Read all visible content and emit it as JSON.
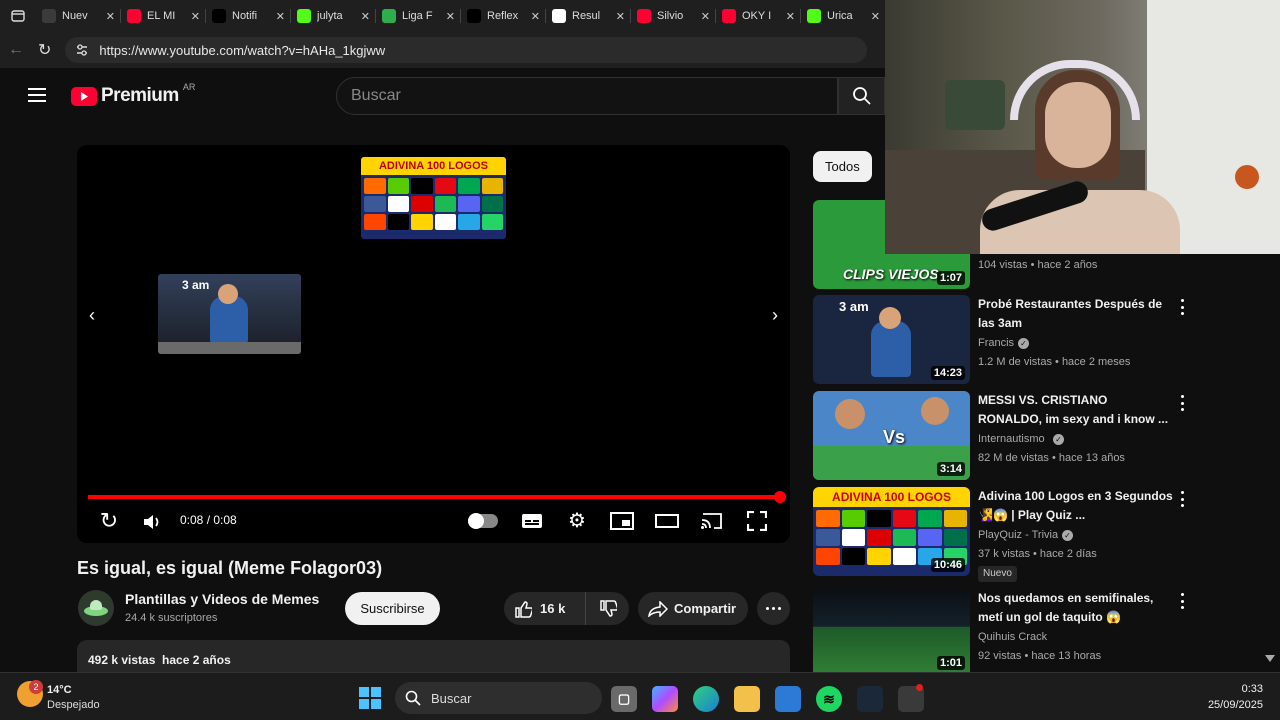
{
  "browser": {
    "tabs": [
      {
        "label": "Nuev",
        "icon": "news-icon",
        "color": "#3b3b3b"
      },
      {
        "label": "EL MI",
        "icon": "youtube-icon",
        "color": "#ff0033"
      },
      {
        "label": "Notifi",
        "icon": "x-icon",
        "color": "#000000"
      },
      {
        "label": "julyta",
        "icon": "kick-icon",
        "color": "#53fc18"
      },
      {
        "label": "Liga F",
        "icon": "soccer-icon",
        "color": "#2eae4e"
      },
      {
        "label": "Reflex",
        "icon": "tiktok-icon",
        "color": "#000000"
      },
      {
        "label": "Resul",
        "icon": "google-icon",
        "color": "#ffffff"
      },
      {
        "label": "Silvio",
        "icon": "youtube-icon",
        "color": "#ff0033"
      },
      {
        "label": "OKY I",
        "icon": "youtube-icon",
        "color": "#ff0033"
      },
      {
        "label": "Urica",
        "icon": "kick-icon",
        "color": "#53fc18"
      }
    ],
    "url": "https://www.youtube.com/watch?v=hAHa_1kgjww"
  },
  "header": {
    "logo_text": "Premium",
    "region": "AR",
    "search_placeholder": "Buscar"
  },
  "player": {
    "time": "0:08 / 0:08",
    "progress": 1.0,
    "end_cards": {
      "big_title_line1": "ADIVINA 100 LOGOS",
      "small_label": "3 am"
    }
  },
  "video": {
    "title": "Es igual, es igual (Meme Folagor03)",
    "channel": "Plantillas y Videos de Memes",
    "subscribers": "24.4 k suscriptores",
    "subscribe_label": "Suscribirse",
    "likes": "16 k",
    "share_label": "Compartir",
    "views_date": "492 k vistas  hace 2 años"
  },
  "sidebar": {
    "chip": "Todos",
    "items": [
      {
        "thumb_text": "CLIPS VIEJOS",
        "duration": "1:07",
        "meta": "104 vistas • hace 2 años",
        "thumb_color": "#2a9a3a"
      },
      {
        "title": "Probé Restaurantes Después de las 3am",
        "channel": "Francis",
        "meta": "1.2 M de vistas • hace 2 meses",
        "duration": "14:23",
        "thumb_text": "3 am",
        "thumb_color": "#1a2540"
      },
      {
        "title": "MESSI VS. CRISTIANO RONALDO, im sexy and i know ...",
        "channel": "Internautismo",
        "meta": "82 M de vistas • hace 13 años",
        "duration": "3:14",
        "thumb_text": "Vs",
        "thumb_color": "#4a86c8"
      },
      {
        "title": "Adivina 100 Logos en 3 Segundos 🧏‍♀️😱 | Play Quiz ...",
        "channel": "PlayQuiz - Trivia",
        "meta": "37 k vistas • hace 2 días",
        "duration": "10:46",
        "badge": "Nuevo",
        "thumb_text": "ADIVINA 100 LOGOS",
        "thumb_color": "#c23b3b"
      },
      {
        "title": "Nos quedamos en semifinales, metí un gol de taquito 😱",
        "channel": "Quihuis Crack",
        "meta": "92 vistas • hace 13 horas",
        "duration": "1:01",
        "thumb_color": "#1e5a2a"
      }
    ]
  },
  "taskbar": {
    "weather_temp": "14°C",
    "weather_desc": "Despejado",
    "weather_badge": "2",
    "search_label": "Buscar",
    "time": "0:33",
    "date": "25/09/2025"
  }
}
